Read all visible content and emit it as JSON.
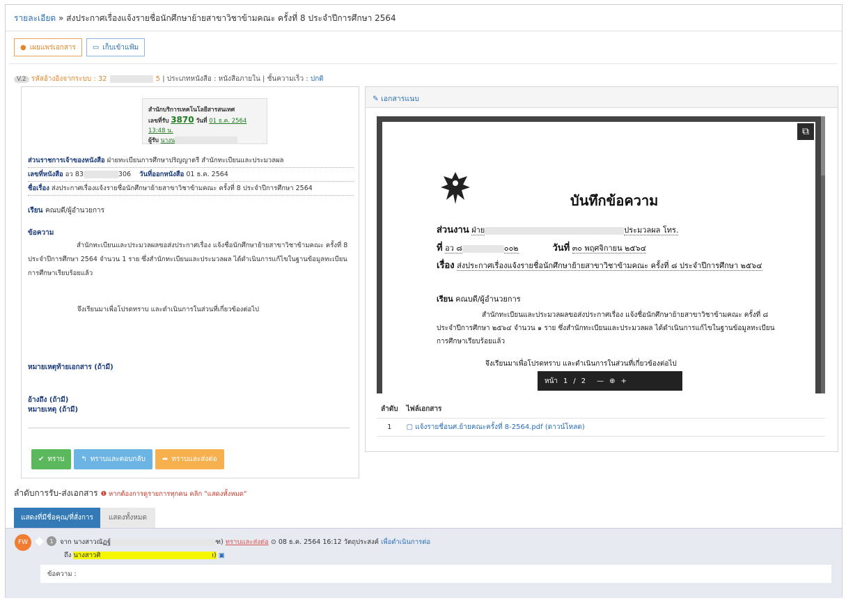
{
  "header": {
    "crumb": "รายละเอียด",
    "sep": " » ",
    "title": "ส่งประกาศเรื่องแจ้งรายชื่อนักศึกษาย้ายสาขาวิชาข้ามคณะ ครั้งที่ 8 ประจำปีการศึกษา 2564"
  },
  "toolbar": {
    "publish": "เผยแพร่เอกสาร",
    "archive": "เก็บเข้าแฟ้ม"
  },
  "meta": {
    "version": "V.2",
    "ref_label": "รหัสอ้างอิงจากระบบ : 32",
    "ref_end": "5",
    "doc_type": "ประเภทหนังสือ : หนังสือภายใน",
    "speed_label": "ชั้นความเร็ว :",
    "speed": "ปกติ"
  },
  "stamp": {
    "org": "สำนักบริการเทคโนโลยีสารสนเทศ",
    "recv_label": "เลขที่รับ",
    "recv_no": "3870",
    "date_label": "วันที่",
    "date": "01 ธ.ค. 2564 13:48 น.",
    "by_label": "ผู้รับ",
    "by": "นางน"
  },
  "info": {
    "owner_label": "ส่วนราชการเจ้าของหนังสือ",
    "owner": "ฝ่ายทะเบียนการศึกษาปริญญาตรี สำนักทะเบียนและประมวลผล",
    "docno_label": "เลขที่หนังสือ",
    "docno_a": "อว 83",
    "docno_b": "306",
    "issue_label": "วันที่ออกหนังสือ",
    "issue": "01 ธ.ค. 2564",
    "subject_label": "ชื่อเรื่อง",
    "subject": "ส่งประกาศเรื่องแจ้งรายชื่อนักศึกษาย้ายสาขาวิชาข้ามคณะ ครั้งที่ 8 ประจำปีการศึกษา 2564"
  },
  "to_label": "เรียน",
  "to": "คณบดี/ผู้อำนวยการ",
  "msg_label": "ข้อความ",
  "msg_body": "สำนักทะเบียนและประมวลผลขอส่งประกาศเรื่อง   แจ้งชื่อนักศึกษาย้ายสาขาวิชาข้ามคณะ ครั้งที่ 8 ประจำปีการศึกษา 2564 จำนวน 1 ราย ซึ่งสำนักทะเบียนและประมวลผล ได้ดำเนินการแก้ไขในฐานข้อมูลทะเบียนการศึกษาเรียบร้อยแล้ว",
  "msg_close": "จึงเรียนมาเพื่อโปรดทราบ  และดำเนินการในส่วนที่เกี่ยวข้องต่อไป",
  "footnote_label": "หมายเหตุท้ายเอกสาร (ถ้ามี)",
  "ref_label": "อ้างถึง (ถ้ามี)",
  "remark_label": "หมายเหตุ (ถ้ามี)",
  "actions": {
    "ack": "ทราบ",
    "ack_reply": "ทราบและตอบกลับ",
    "ack_forward": "ทราบและส่งต่อ"
  },
  "attach": {
    "header": "เอกสารแนบ",
    "preview": {
      "title": "บันทึกข้อความ",
      "dept_label": "ส่วนงาน",
      "dept": "ฝ่าย",
      "dept_tail": "ประมวลผล  โทร.",
      "no_label": "ที่",
      "no": "อว ๘",
      "no_tail": "๐๐๒",
      "date_label": "วันที่",
      "date": "๓๐  พฤศจิกายน  ๒๕๖๔",
      "subj_label": "เรื่อง",
      "subj": "ส่งประกาศเรื่องแจ้งรายชื่อนักศึกษาย้ายสาขาวิชาข้ามคณะ ครั้งที่ ๘ ประจำปีการศึกษา ๒๕๖๔",
      "to_label": "เรียน",
      "to": "คณบดี/ผู้อำนวยการ",
      "body": "สำนักทะเบียนและประมวลผลขอส่งประกาศเรื่อง แจ้งชื่อนักศึกษาย้ายสาขาวิชาข้ามคณะ ครั้งที่ ๘ ประจำปีการศึกษา ๒๕๖๔ จำนวน ๑ ราย ซึ่งสำนักทะเบียนและประมวลผล ได้ดำเนินการแก้ไขในฐานข้อมูลทะเบียนการศึกษาเรียบร้อยแล้ว",
      "close": "จึงเรียนมาเพื่อโปรดทราบ  และดำเนินการในส่วนที่เกี่ยวข้องต่อไป"
    },
    "pager": {
      "label": "หน้า",
      "page": "1",
      "sep": "/",
      "total": "2",
      "minus": "—",
      "plus": "+"
    },
    "table": {
      "col_no": "ลำดับ",
      "col_file": "ไฟล์เอกสาร",
      "rows": [
        {
          "no": "1",
          "file": "แจ้งรายชื่อนศ.ย้ายคณะครั้งที่ 8-2564.pdf",
          "dl": "(ดาวน์โหลด)"
        }
      ]
    }
  },
  "flow": {
    "title": "ลำดับการรับ-ส่งเอกสาร",
    "note": "หากต้องการดูรายการทุกคน คลิก \"แสดงทั้งหมด\"",
    "tab_mine": "แสดงที่มีชื่อคุณ/ที่สั่งการ",
    "tab_all": "แสดงทั้งหมด",
    "entry": {
      "avatar": "FW",
      "step": "1",
      "from_label": "จาก",
      "from": "นางสาวณัฏฐ์",
      "from_tail": "ฑ)",
      "action": "ทราบและส่งต่อ",
      "time": "08 ธ.ค. 2564 16:12",
      "purpose_label": "วัตถุประสงค์",
      "purpose": "เพื่อดำเนินการต่อ",
      "to_label": "ถึง",
      "to": "นางสาวศิ",
      "to_tail": "ı)",
      "msg_label": "ข้อความ :"
    }
  }
}
